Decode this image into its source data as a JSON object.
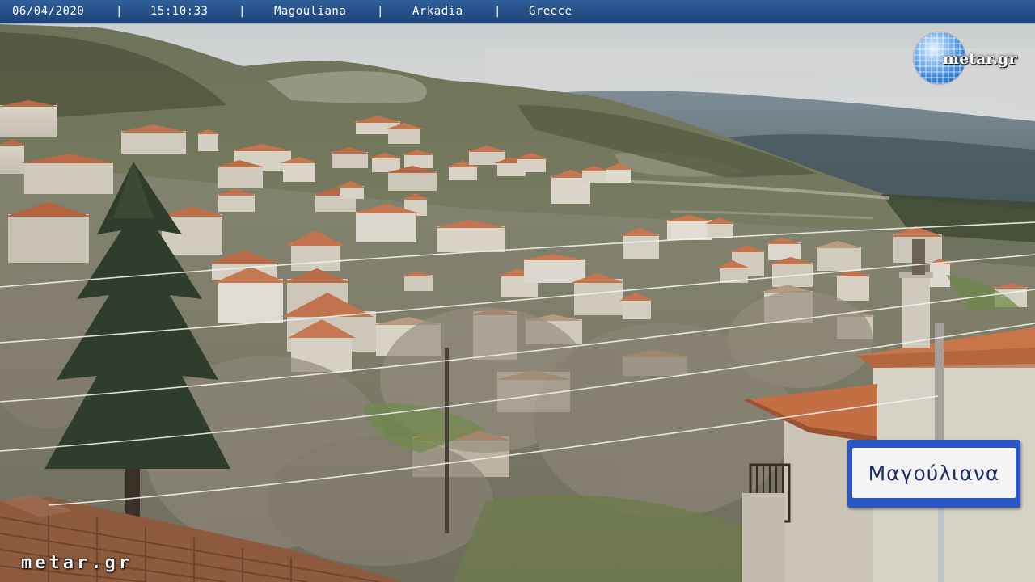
{
  "overlay": {
    "date": "06/04/2020",
    "time": "15:10:33",
    "village": "Magouliana",
    "region": "Arkadia",
    "country": "Greece",
    "separator": "|"
  },
  "logo_top_right": {
    "text": "metar.gr"
  },
  "logo_bottom_left": {
    "text": "metar.gr"
  },
  "road_sign": {
    "text": "Μαγούλιανα"
  },
  "colors": {
    "bar_top": "#2f5f9a",
    "bar_bottom": "#1d4478",
    "sign_blue": "#2a56c6",
    "roof_terracotta": "#c0714a"
  }
}
